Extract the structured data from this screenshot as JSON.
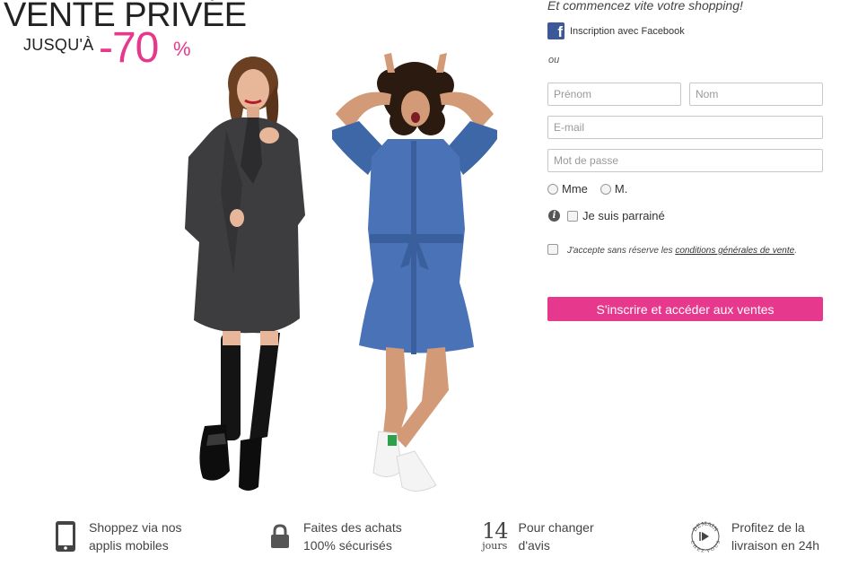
{
  "hero": {
    "title": "VENTE PRIVÉE",
    "upto": "JUSQU'À",
    "discount": "-70",
    "percent": "%"
  },
  "signup": {
    "tagline": "Et commencez vite votre shopping!",
    "facebook_label": "Inscription avec Facebook",
    "or_label": "ou",
    "firstname_placeholder": "Prénom",
    "lastname_placeholder": "Nom",
    "email_placeholder": "E-mail",
    "password_placeholder": "Mot de passe",
    "gender_options": [
      "Mme",
      "M."
    ],
    "sponsor_label": "Je suis parrainé",
    "terms_prefix": "J'accepte sans réserve les",
    "terms_link": "conditions générales de vente",
    "terms_suffix": ".",
    "submit_label": "S'inscrire et accéder aux ventes"
  },
  "features": [
    {
      "icon": "smartphone-icon",
      "line1": "Shoppez via nos",
      "line2": "applis mobiles"
    },
    {
      "icon": "padlock-icon",
      "line1": "Faites des achats",
      "line2": "100% sécurisés"
    },
    {
      "icon": "calendar-days-icon",
      "badge_number": "14",
      "badge_word": "jours",
      "line1": "Pour changer",
      "line2": "d'avis"
    },
    {
      "icon": "delivery-seal-icon",
      "seal_top": "DEMAIN",
      "seal_bottom": "CHEZ VOUS",
      "line1": "Profitez de la",
      "line2": "livraison en 24h"
    }
  ],
  "colors": {
    "accent": "#e6388c",
    "facebook": "#3b5998",
    "text": "#333333"
  }
}
